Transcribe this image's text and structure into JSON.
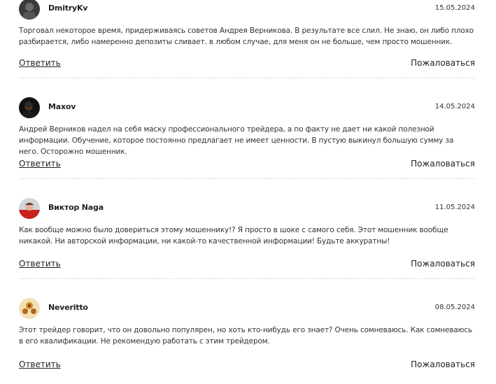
{
  "comments": [
    {
      "author": "DmitryKv",
      "date": "15.05.2024",
      "text": "Торговал некоторое время, придерживаясь советов Андрея Верникова. В результате все слил. Не знаю, он либо плохо разбирается, либо намеренно депозиты сливает. в любом случае, для меня он не больше, чем просто мошенник.",
      "reply_label": "Ответить",
      "complain_label": "Пожаловаться"
    },
    {
      "author": "Maxov",
      "date": "14.05.2024",
      "text": "Андрей Верников надел на себя маску профессионального трейдера, а по факту не дает ни какой полезной информации. Обучение, которое постоянно предлагает не имеет ценности. В пустую выкинул большую сумму за него. Осторожно мошенник.",
      "reply_label": "Ответить",
      "complain_label": "Пожаловаться"
    },
    {
      "author": "Виктор Naga",
      "date": "11.05.2024",
      "text": "Как вообще можно было довериться этому мошеннику!? Я просто в шоке с самого себя. Этот мошенник вообще никакой. Ни авторской информации, ни какой-то качественной информации! Будьте аккуратны!",
      "reply_label": "Ответить",
      "complain_label": "Пожаловаться"
    },
    {
      "author": "Neveritto",
      "date": "08.05.2024",
      "text": "Этот трейдер говорит, что он довольно популярен, но хоть кто-нибудь его знает? Очень сомневаюсь. Как сомневаюсь в его квалификации. Не рекомендую работать с этим трейдером.",
      "reply_label": "Ответить",
      "complain_label": "Пожаловаться"
    }
  ]
}
